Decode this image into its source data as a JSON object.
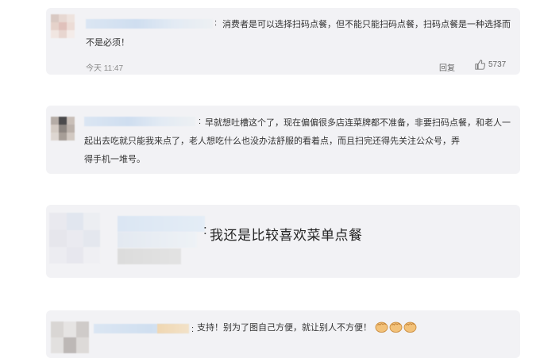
{
  "comments": [
    {
      "text": "消费者是可以选择扫码点餐，但不能只能扫码点餐，扫码点餐是一种选择而不是必须！",
      "line1": "消费者是可以选择扫码点餐，但不能只能扫码点餐，扫码点餐是一种选择而",
      "line2": "不是必须！",
      "time": "今天 11:47",
      "reply_label": "回复",
      "like_count": "5737",
      "like_icon": "thumbs-up-icon"
    },
    {
      "text": "早就想吐槽这个了，现在偏偏很多店连菜牌都不准备，非要扫码点餐，和老人一起出去吃就只能我来点了，老人想吃什么也没办法舒服的看着点，而且扫完还得先关注公众号，弄得手机一堆号。",
      "line1": "早就想吐槽这个了，现在偏偏很多店连菜牌都不准备，非要扫码点餐，和老人一",
      "line2": "起出去吃就只能我来点了，老人想吃什么也没办法舒服的看着点，而且扫完还得先关注公众号，弄",
      "line3": "得手机一堆号。"
    },
    {
      "text": "我还是比较喜欢菜单点餐"
    },
    {
      "text": "支持！别为了图自己方便，就让别人不方便！",
      "emoji_icon": "fist-emoji-icon"
    }
  ],
  "colors": {
    "card_bg": "#f2f2f5",
    "meta_gray": "#8a8a8a",
    "blurred_name": "#cfdef0"
  }
}
